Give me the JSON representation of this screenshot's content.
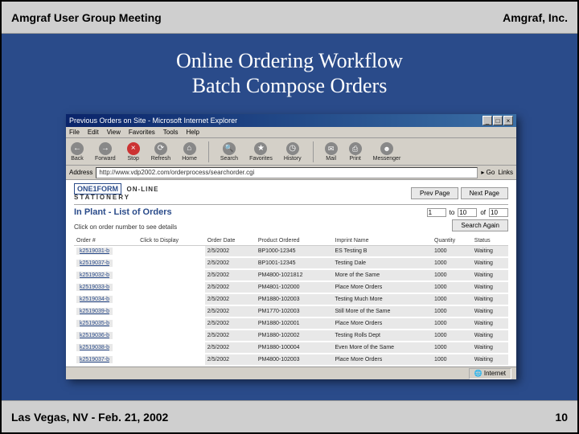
{
  "header": {
    "left": "Amgraf User Group Meeting",
    "right": "Amgraf, Inc."
  },
  "footer": {
    "left": "Las Vegas, NV - Feb. 21, 2002",
    "right": "10"
  },
  "title": {
    "line1": "Online Ordering Workflow",
    "line2": "Batch Compose Orders"
  },
  "browser": {
    "window_title": "Previous Orders on Site - Microsoft Internet Explorer",
    "menus": [
      "File",
      "Edit",
      "View",
      "Favorites",
      "Tools",
      "Help"
    ],
    "toolbar": {
      "back": "Back",
      "forward": "Forward",
      "stop": "Stop",
      "refresh": "Refresh",
      "home": "Home",
      "search": "Search",
      "favorites": "Favorites",
      "history": "History",
      "mail": "Mail",
      "print": "Print",
      "messenger": "Messenger"
    },
    "address_label": "Address",
    "address_url": "http://www.vdp2002.com/orderprocess/searchorder.cgi",
    "go": "Go",
    "links": "Links",
    "status_zone": "Internet"
  },
  "page": {
    "brand_oneform": "ONE1FORM",
    "brand_online": "ON-LINE",
    "brand_stationery": "STATIONERY",
    "prev_page": "Prev Page",
    "next_page": "Next Page",
    "section_title": "In Plant - List of Orders",
    "range_from": "1",
    "range_to_label": "to",
    "range_to": "10",
    "range_of_label": "of",
    "range_of": "10",
    "search_again": "Search Again",
    "instruction": "Click on order number to see details",
    "columns": {
      "orderno": "Order #",
      "clickto": "Click to Display",
      "orderdate": "Order Date",
      "product": "Product Ordered",
      "imprint": "Imprint Name",
      "quantity": "Quantity",
      "status": "Status"
    },
    "rows": [
      {
        "orderno": "k2519031-b",
        "date": "2/5/2002",
        "product": "BP1000-12345",
        "imprint": "ES Testing B",
        "qty": "1000",
        "status": "Waiting"
      },
      {
        "orderno": "k2519037-b",
        "date": "2/5/2002",
        "product": "BP1001-12345",
        "imprint": "Testing Dale",
        "qty": "1000",
        "status": "Waiting"
      },
      {
        "orderno": "k2519032-b",
        "date": "2/5/2002",
        "product": "PM4800-1021812",
        "imprint": "More of the Same",
        "qty": "1000",
        "status": "Waiting"
      },
      {
        "orderno": "k2519033-b",
        "date": "2/5/2002",
        "product": "PM4801-102000",
        "imprint": "Place More Orders",
        "qty": "1000",
        "status": "Waiting"
      },
      {
        "orderno": "k2519034-b",
        "date": "2/5/2002",
        "product": "PM1880-102003",
        "imprint": "Testing Much More",
        "qty": "1000",
        "status": "Waiting"
      },
      {
        "orderno": "k2519039-b",
        "date": "2/5/2002",
        "product": "PM1770-102003",
        "imprint": "Still More of the Same",
        "qty": "1000",
        "status": "Waiting"
      },
      {
        "orderno": "k2519035-b",
        "date": "2/5/2002",
        "product": "PM1880-102001",
        "imprint": "Place More Orders",
        "qty": "1000",
        "status": "Waiting"
      },
      {
        "orderno": "k2519036-b",
        "date": "2/5/2002",
        "product": "PM1880-102002",
        "imprint": "Testing Rolls Dept",
        "qty": "1000",
        "status": "Waiting"
      },
      {
        "orderno": "k2519038-b",
        "date": "2/5/2002",
        "product": "PM1880-100004",
        "imprint": "Even More of the Same",
        "qty": "1000",
        "status": "Waiting"
      },
      {
        "orderno": "k2519037-b",
        "date": "2/5/2002",
        "product": "PM4800-102003",
        "imprint": "Place More Orders",
        "qty": "1000",
        "status": "Waiting"
      }
    ]
  }
}
